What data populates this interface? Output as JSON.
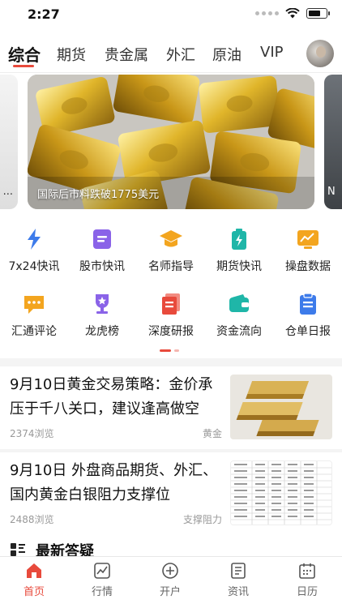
{
  "status_bar": {
    "time": "2:27"
  },
  "top_tabs": {
    "items": [
      "综合",
      "期货",
      "贵金属",
      "外汇",
      "原油",
      "VIP"
    ],
    "active_index": 0,
    "accent_color": "#e84a3c"
  },
  "banner": {
    "caption": "国际后市料跌破1775美元",
    "left_peek_text": "...",
    "right_peek_text": "N",
    "active_page": 1
  },
  "shortcuts": {
    "row1": [
      {
        "label": "7x24快讯",
        "icon": "lightning-icon",
        "color": "#3d7bea"
      },
      {
        "label": "股市快讯",
        "icon": "document-icon",
        "color": "#8a63e8"
      },
      {
        "label": "名师指导",
        "icon": "graduation-cap-icon",
        "color": "#f3a51f"
      },
      {
        "label": "期货快讯",
        "icon": "battery-bolt-icon",
        "color": "#1fb6a8"
      },
      {
        "label": "操盘数据",
        "icon": "chart-monitor-icon",
        "color": "#f3a51f"
      }
    ],
    "row2": [
      {
        "label": "汇通评论",
        "icon": "chat-bubble-icon",
        "color": "#f3a51f"
      },
      {
        "label": "龙虎榜",
        "icon": "trophy-icon",
        "color": "#8a63e8"
      },
      {
        "label": "深度研报",
        "icon": "report-stack-icon",
        "color": "#e84a3c"
      },
      {
        "label": "资金流向",
        "icon": "wallet-icon",
        "color": "#1fb6a8"
      },
      {
        "label": "仓单日报",
        "icon": "clipboard-icon",
        "color": "#3d7bea"
      }
    ]
  },
  "articles": [
    {
      "title": "9月10日黄金交易策略：金价承压于千八关口，建议逢高做空",
      "views": "2374浏览",
      "tag": "黄金",
      "thumb": "gold-bars-thumbnail"
    },
    {
      "title": "9月10日 外盘商品期货、外汇、国内黄金白银阻力支撑位",
      "views": "2488浏览",
      "tag": "支撑阻力",
      "thumb": "price-table-thumbnail"
    }
  ],
  "faq_section": {
    "title": "最新答疑"
  },
  "bottom_nav": {
    "items": [
      {
        "label": "首页",
        "icon": "home-icon"
      },
      {
        "label": "行情",
        "icon": "market-chart-icon"
      },
      {
        "label": "开户",
        "icon": "plus-circle-icon"
      },
      {
        "label": "资讯",
        "icon": "news-icon"
      },
      {
        "label": "日历",
        "icon": "calendar-icon"
      }
    ],
    "active_index": 0
  }
}
